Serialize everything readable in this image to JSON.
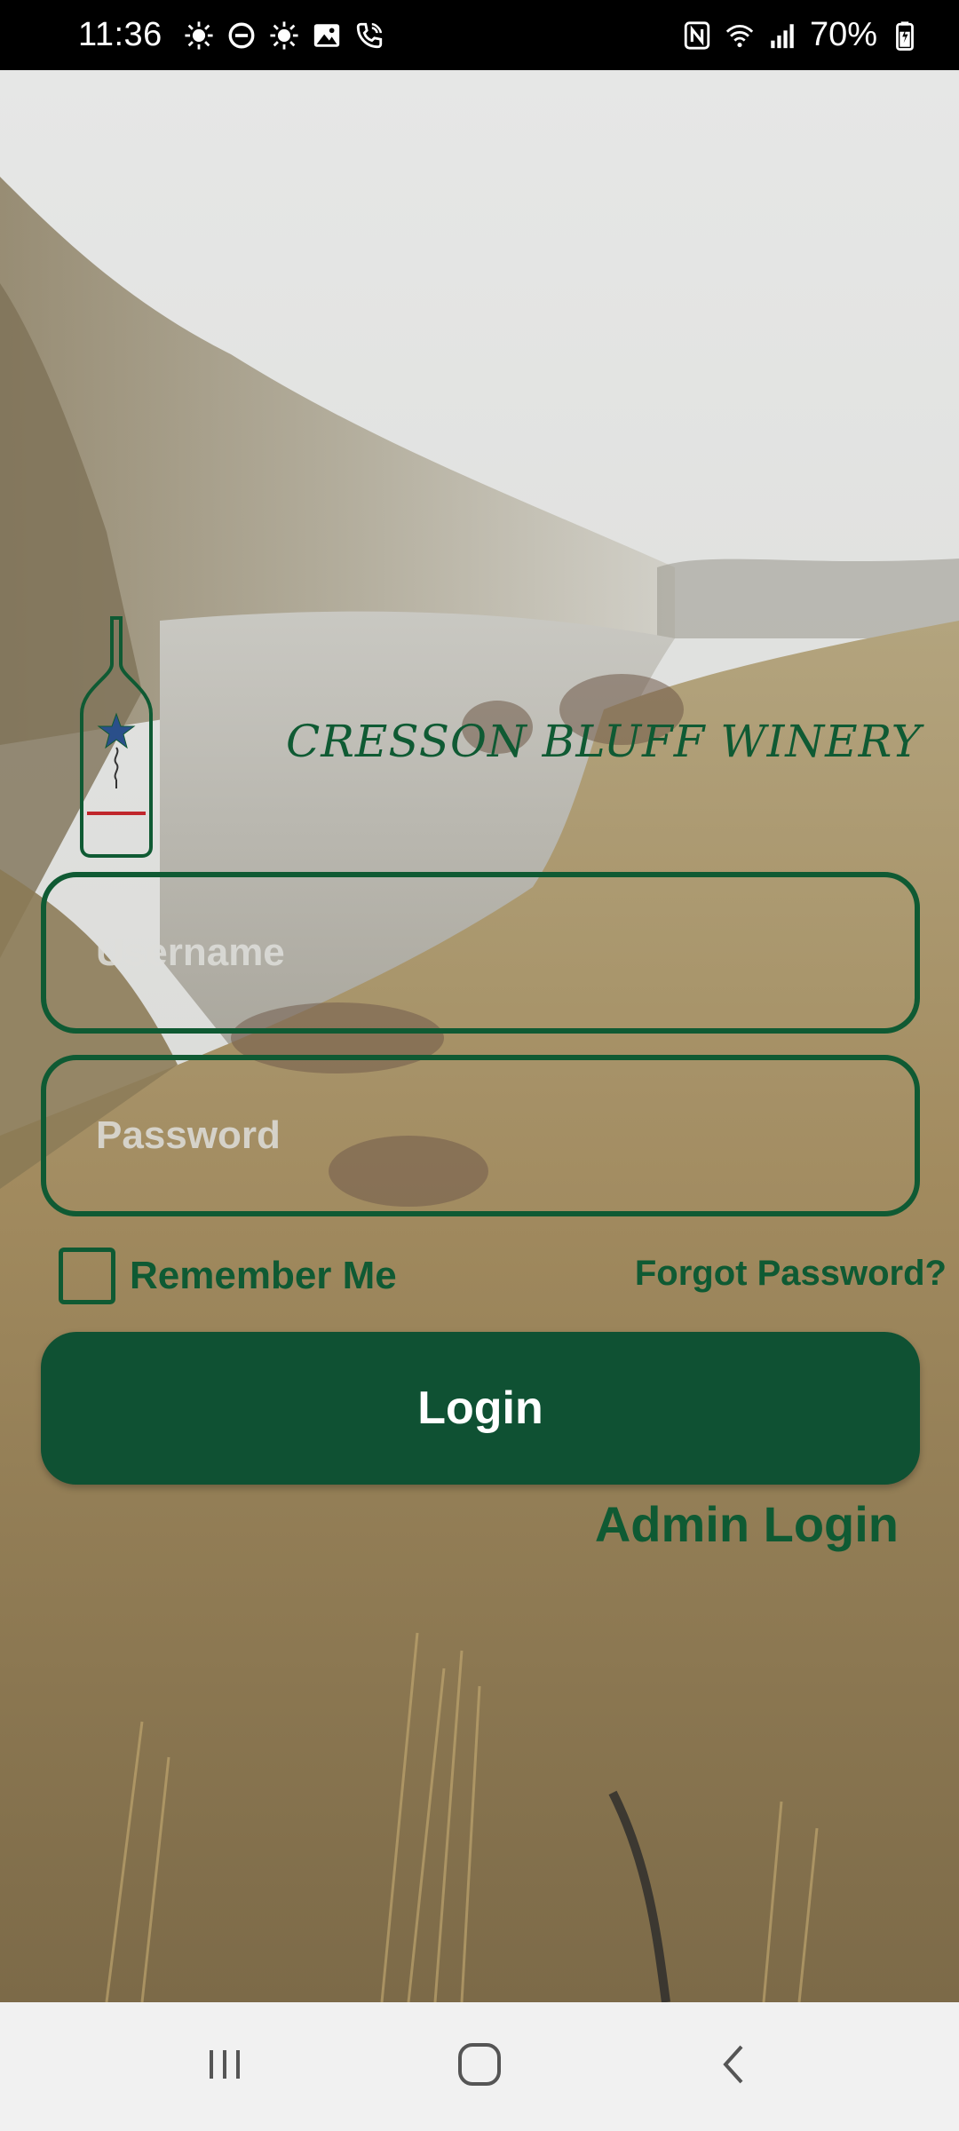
{
  "status_bar": {
    "time": "11:36",
    "battery": "70%",
    "left_icons": [
      "weather-icon",
      "dnd-icon",
      "weather-icon",
      "gallery-icon",
      "wifi-call-icon"
    ],
    "right_icons": [
      "nfc-icon",
      "wifi-icon",
      "signal-icon",
      "battery-icon"
    ]
  },
  "brand": {
    "name": "CRESSON BLUFF WINERY",
    "logo_icon": "wine-bottle-star-logo",
    "color": "#0f5a33"
  },
  "form": {
    "username_placeholder": "Username",
    "username_value": "",
    "password_placeholder": "Password",
    "password_value": "",
    "remember_label": "Remember Me",
    "remember_checked": false,
    "forgot_label": "Forgot Password?",
    "login_label": "Login",
    "admin_label": "Admin Login"
  },
  "nav": {
    "recents_icon": "recents-icon",
    "home_icon": "home-icon",
    "back_icon": "back-icon"
  },
  "colors": {
    "accent": "#0f5133",
    "text_green": "#0f5a33",
    "nav_bg": "#f1f1f1"
  }
}
